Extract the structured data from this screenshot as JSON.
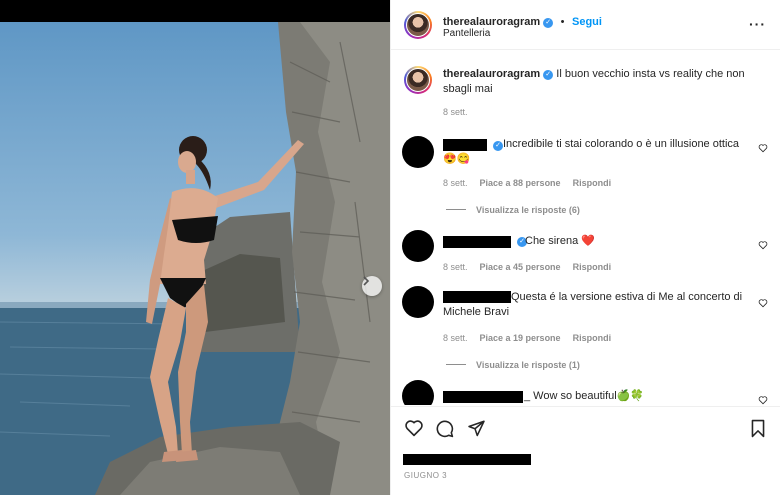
{
  "post": {
    "username": "therealauroragram",
    "follow_label": "Segui",
    "location": "Pantelleria",
    "more_label": "···",
    "caption": "Il buon vecchio insta vs reality che non sbagli mai",
    "caption_time": "8 sett.",
    "date": "GIUGNO 3"
  },
  "comments": [
    {
      "text": "Incredibile ti stai colorando o è un illusione ottica 😍😋",
      "time": "8 sett.",
      "likes": "Piace a 88 persone",
      "reply": "Rispondi",
      "view_replies": "Visualizza le risposte (6)"
    },
    {
      "text": "Che sirena ❤️",
      "time": "8 sett.",
      "likes": "Piace a 45 persone",
      "reply": "Rispondi"
    },
    {
      "text": "Questa é la versione estiva di Me al concerto di Michele Bravi",
      "time": "8 sett.",
      "likes": "Piace a 19 persone",
      "reply": "Rispondi",
      "view_replies": "Visualizza le risposte (1)"
    },
    {
      "text": "_ Wow so beautiful🍏🍀"
    }
  ],
  "icons": [
    "heart-icon",
    "comment-icon",
    "share-icon",
    "bookmark-icon",
    "chevron-right-icon",
    "verified-icon",
    "more-icon"
  ],
  "colors": {
    "link": "#0095f6",
    "verified": "#3897f0",
    "muted": "#8e8e8e"
  }
}
